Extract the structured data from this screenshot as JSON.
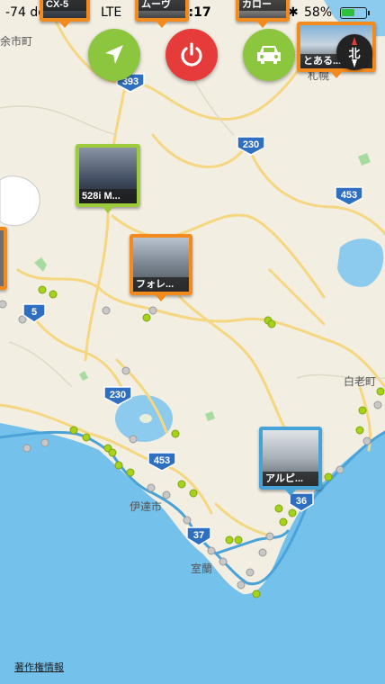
{
  "status_bar": {
    "carrier": "-74 docomo",
    "network": "LTE",
    "time": "15:17",
    "battery_percent": "58%",
    "battery_level": 0.58
  },
  "map": {
    "place_labels": [
      "余市町",
      "札幌",
      "白老町",
      "伊達市",
      "室蘭"
    ],
    "route_shields": [
      "393",
      "230",
      "453",
      "5",
      "230",
      "453",
      "36",
      "37"
    ],
    "copyright_link": "著作権情報",
    "route_color": "#4aa3d8",
    "sea_color": "#74c2ec",
    "land_color": "#f3eee2",
    "road_color": "#f5d782",
    "point_green": "#a6d319",
    "point_gray": "#c8c8c8"
  },
  "controls": {
    "locate_button": {
      "icon": "location-arrow-icon",
      "color": "#8cc63f"
    },
    "power_button": {
      "icon": "power-icon",
      "color": "#e63b3b"
    },
    "car_button": {
      "icon": "car-icon",
      "color": "#8cc63f"
    },
    "compass_label": "北"
  },
  "photo_markers": [
    {
      "caption": "528i M...",
      "frame_color": "#9ccb3b"
    },
    {
      "caption": "フォレ...",
      "frame_color": "#f28a1e"
    },
    {
      "caption": "アルピ...",
      "frame_color": "#46a3d8"
    },
    {
      "caption": "とある...",
      "frame_color": "#f28a1e"
    },
    {
      "caption": "CX-5",
      "frame_color": "#f28a1e"
    },
    {
      "caption": "ムーヴ",
      "frame_color": "#f28a1e"
    },
    {
      "caption": "カロー",
      "frame_color": "#f28a1e"
    }
  ]
}
